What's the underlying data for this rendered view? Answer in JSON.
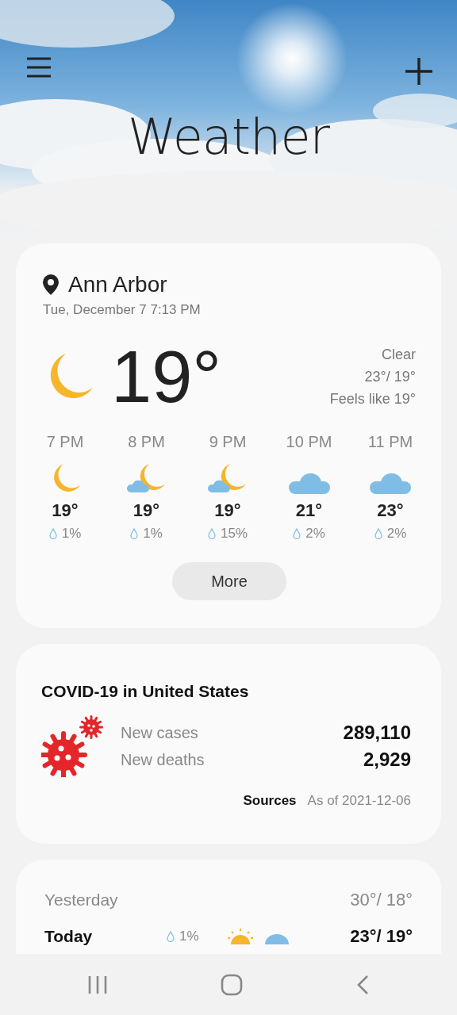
{
  "header": {
    "title": "Weather"
  },
  "current": {
    "location": "Ann Arbor",
    "datetime": "Tue, December 7 7:13 PM",
    "kind": "moon",
    "temperature": "19°",
    "condition": "Clear",
    "high_low": "23°/ 19°",
    "feels_like": "Feels like 19°"
  },
  "hourly": [
    {
      "time": "7 PM",
      "kind": "moon",
      "temperature": "19°",
      "precipitation": "1%"
    },
    {
      "time": "8 PM",
      "kind": "moon-cloud",
      "temperature": "19°",
      "precipitation": "1%"
    },
    {
      "time": "9 PM",
      "kind": "moon-cloud",
      "temperature": "19°",
      "precipitation": "15%"
    },
    {
      "time": "10 PM",
      "kind": "cloud",
      "temperature": "21°",
      "precipitation": "2%"
    },
    {
      "time": "11 PM",
      "kind": "cloud",
      "temperature": "23°",
      "precipitation": "2%"
    }
  ],
  "more_button": "More",
  "covid": {
    "title": "COVID-19 in United States",
    "stats": [
      {
        "label": "New cases",
        "value": "289,110"
      },
      {
        "label": "New deaths",
        "value": "2,929"
      }
    ],
    "sources": "Sources",
    "as_of": "As of 2021-12-06"
  },
  "daily": [
    {
      "day": "Yesterday",
      "selected": false,
      "high_low": "30°/ 18°"
    },
    {
      "day": "Today",
      "selected": true,
      "precipitation": "1%",
      "icons": [
        {
          "kind": "sun"
        },
        {
          "kind": "cloud"
        }
      ],
      "high_low": "23°/ 19°"
    }
  ]
}
